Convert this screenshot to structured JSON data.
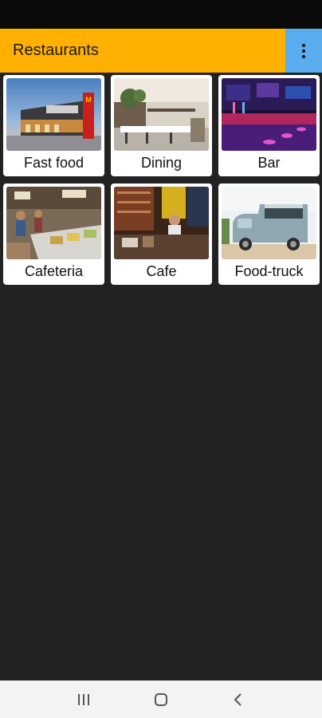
{
  "app_bar": {
    "title": "Restaurants",
    "accent_color": "#ffb000",
    "menu_color": "#5aadee",
    "menu_icon": "more-vert-icon"
  },
  "categories": [
    {
      "label": "Fast food",
      "image": "fast-food-photo"
    },
    {
      "label": "Dining",
      "image": "dining-photo"
    },
    {
      "label": "Bar",
      "image": "bar-photo"
    },
    {
      "label": "Cafeteria",
      "image": "cafeteria-photo"
    },
    {
      "label": "Cafe",
      "image": "cafe-photo"
    },
    {
      "label": "Food-truck",
      "image": "food-truck-photo"
    }
  ],
  "nav_bar": {
    "recents_icon": "recents-icon",
    "home_icon": "home-icon",
    "back_icon": "back-icon"
  }
}
